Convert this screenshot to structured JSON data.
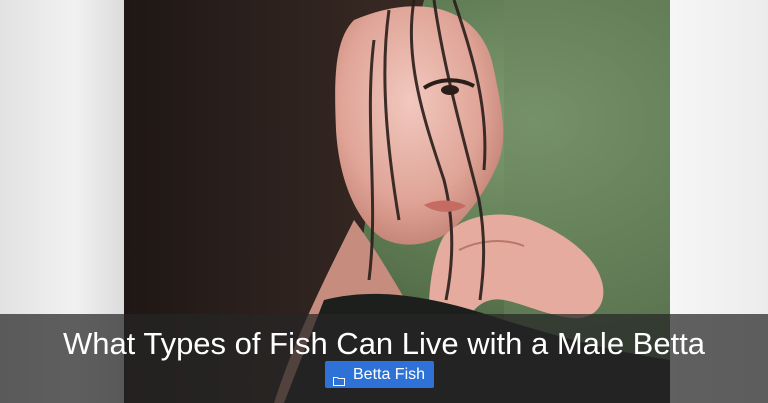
{
  "post": {
    "title": "What Types of Fish Can Live with a Male Betta",
    "category": {
      "label": "Betta Fish",
      "icon": "folder-icon",
      "color": "#2e72d8"
    }
  }
}
